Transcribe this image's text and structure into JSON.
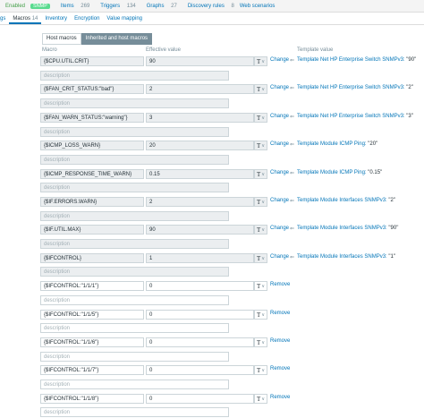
{
  "topbar": {
    "enabled": "Enabled",
    "snmp": "SNMP",
    "items_label": "Items",
    "items_count": "269",
    "triggers_label": "Triggers",
    "triggers_count": "134",
    "graphs_label": "Graphs",
    "graphs_count": "27",
    "discovery_label": "Discovery rules",
    "discovery_count": "8",
    "web_label": "Web scenarios"
  },
  "tabs": {
    "tags": "gs",
    "macros": "Macros",
    "macros_count": "14",
    "inventory": "Inventory",
    "encryption": "Encryption",
    "value_mapping": "Value mapping"
  },
  "subtabs": {
    "host": "Host macros",
    "inherited": "Inherited and host macros"
  },
  "columns": {
    "macro": "Macro",
    "effective": "Effective value",
    "template": "Template value"
  },
  "description_placeholder": "description",
  "inherited_macros": [
    {
      "macro": "{$CPU.UTIL.CRIT}",
      "value": "90",
      "action": "Change",
      "template": "Template Net HP Enterprise Switch SNMPv3:",
      "template_value": "\"90\""
    },
    {
      "macro": "{$FAN_CRIT_STATUS:\"bad\"}",
      "value": "2",
      "action": "Change",
      "template": "Template Net HP Enterprise Switch SNMPv3:",
      "template_value": "\"2\""
    },
    {
      "macro": "{$FAN_WARN_STATUS:\"warning\"}",
      "value": "3",
      "action": "Change",
      "template": "Template Net HP Enterprise Switch SNMPv3:",
      "template_value": "\"3\""
    },
    {
      "macro": "{$ICMP_LOSS_WARN}",
      "value": "20",
      "action": "Change",
      "template": "Template Module ICMP Ping:",
      "template_value": "\"20\""
    },
    {
      "macro": "{$ICMP_RESPONSE_TIME_WARN}",
      "value": "0.15",
      "action": "Change",
      "template": "Template Module ICMP Ping:",
      "template_value": "\"0.15\""
    },
    {
      "macro": "{$IF.ERRORS.WARN}",
      "value": "2",
      "action": "Change",
      "template": "Template Module Interfaces SNMPv3:",
      "template_value": "\"2\""
    },
    {
      "macro": "{$IF.UTIL.MAX}",
      "value": "90",
      "action": "Change",
      "template": "Template Module Interfaces SNMPv3:",
      "template_value": "\"90\""
    },
    {
      "macro": "{$IFCONTROL}",
      "value": "1",
      "action": "Change",
      "template": "Template Module Interfaces SNMPv3:",
      "template_value": "\"1\""
    }
  ],
  "host_macros": [
    {
      "macro": "{$IFCONTROL:\"1/1/1\"}",
      "value": "0",
      "action": "Remove"
    },
    {
      "macro": "{$IFCONTROL:\"1/1/5\"}",
      "value": "0",
      "action": "Remove"
    },
    {
      "macro": "{$IFCONTROL:\"1/1/6\"}",
      "value": "0",
      "action": "Remove"
    },
    {
      "macro": "{$IFCONTROL:\"1/1/7\"}",
      "value": "0",
      "action": "Remove"
    },
    {
      "macro": "{$IFCONTROL:\"1/1/8\"}",
      "value": "0",
      "action": "Remove"
    }
  ],
  "type_glyph": "T",
  "chevron_glyph": "∨",
  "arrow_glyph": "⇐"
}
